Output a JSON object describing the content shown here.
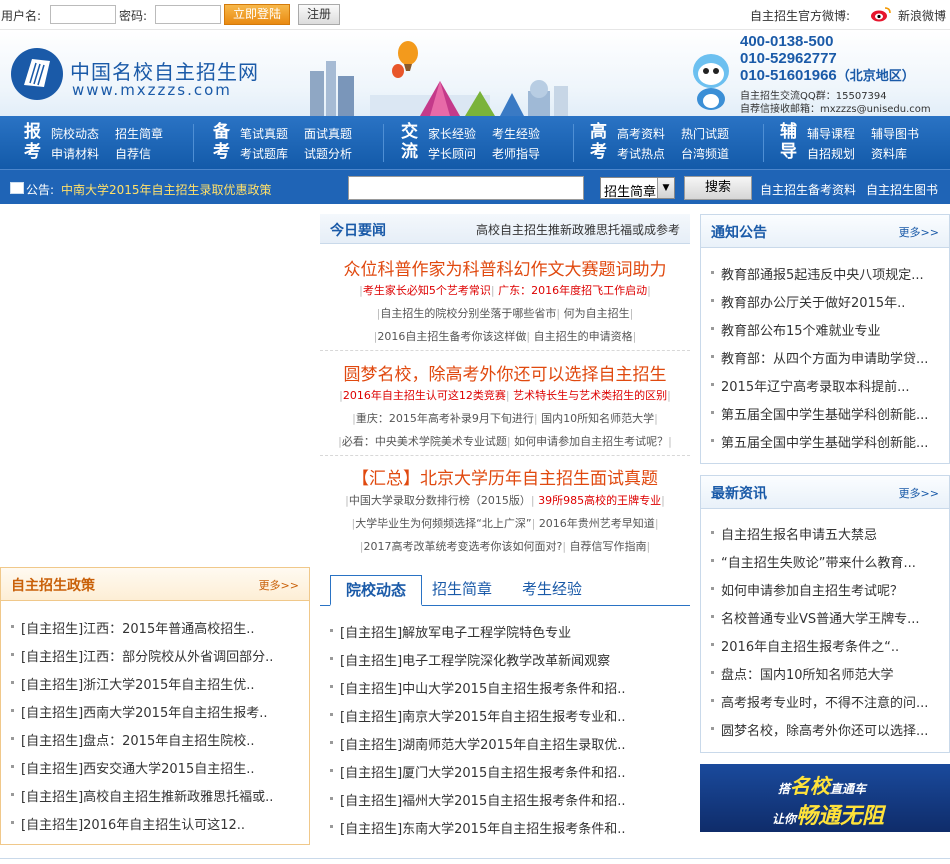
{
  "login": {
    "username_label": "用户名:",
    "password_label": "密码:",
    "login_button": "立即登陆",
    "register_button": "注册",
    "weibo_label": "自主招生官方微博:",
    "weibo_link": "新浪微博"
  },
  "header": {
    "logo_cn": "中国名校自主招生网",
    "logo_en": "www.mxzzzs.com",
    "phones": [
      "400-0138-500",
      "010-52962777",
      "010-51601966"
    ],
    "phone_area": "（北京地区）",
    "qq": "自主招生交流QQ群：15507394",
    "email": "自荐信接收邮箱：mxzzzs@unisedu.com"
  },
  "nav": [
    {
      "cat": "报考",
      "links": [
        "院校动态",
        "招生简章",
        "申请材料",
        "自荐信"
      ]
    },
    {
      "cat": "备考",
      "links": [
        "笔试真题",
        "面试真题",
        "考试题库",
        "试题分析"
      ]
    },
    {
      "cat": "交流",
      "links": [
        "家长经验",
        "考生经验",
        "学长顾问",
        "老师指导"
      ]
    },
    {
      "cat": "高考",
      "links": [
        "高考资料",
        "热门试题",
        "考试热点",
        "台湾频道"
      ]
    },
    {
      "cat": "辅导",
      "links": [
        "辅导课程",
        "辅导图书",
        "自招规划",
        "资料库"
      ]
    }
  ],
  "notice": {
    "label": "公告:",
    "text": "中南大学2015年自主招生录取优惠政策",
    "search_select": "招生简章",
    "search_button": "搜索",
    "links": [
      "自主招生备考资料",
      "自主招生图书"
    ]
  },
  "today": {
    "title": "今日要闻",
    "right": "高校自主招生推新政雅思托福或成参考",
    "blocks": [
      {
        "headline": "众位科普作家为科普科幻作文大赛题词助力",
        "lines": [
          [
            {
              "t": "考生家长必知5个艺考常识",
              "red": true
            },
            {
              "t": "广东：2016年度招飞工作启动",
              "red": true
            }
          ],
          [
            {
              "t": "自主招生的院校分别坐落于哪些省市",
              "red": false
            },
            {
              "t": "何为自主招生",
              "red": false
            }
          ],
          [
            {
              "t": "2016自主招生备考你该这样做",
              "red": false
            },
            {
              "t": "自主招生的申请资格",
              "red": false
            }
          ]
        ]
      },
      {
        "headline": "圆梦名校，除高考外你还可以选择自主招生",
        "lines": [
          [
            {
              "t": "2016年自主招生认可这12类竞赛",
              "red": true
            },
            {
              "t": "艺术特长生与艺术类招生的区别",
              "red": true
            }
          ],
          [
            {
              "t": "重庆：2015年高考补录9月下旬进行",
              "red": false
            },
            {
              "t": "国内10所知名师范大学",
              "red": false
            }
          ],
          [
            {
              "t": "必看：中央美术学院美术专业试题",
              "red": false
            },
            {
              "t": "如何申请参加自主招生考试呢？",
              "red": false
            }
          ]
        ]
      },
      {
        "headline": "【汇总】北京大学历年自主招生面试真题",
        "lines": [
          [
            {
              "t": "中国大学录取分数排行榜（2015版）",
              "red": false
            },
            {
              "t": "39所985高校的王牌专业",
              "red": true
            }
          ],
          [
            {
              "t": "大学毕业生为何频频选择“北上广深”",
              "red": false
            },
            {
              "t": "2016年贵州艺考早知道",
              "red": false
            }
          ],
          [
            {
              "t": "2017高考改革统考变选考你该如何面对?",
              "red": false
            },
            {
              "t": "自荐信写作指南",
              "red": false
            }
          ]
        ]
      }
    ]
  },
  "tabs": [
    "院校动态",
    "招生简章",
    "考生经验"
  ],
  "center_list": [
    "[自主招生]解放军电子工程学院特色专业",
    "[自主招生]电子工程学院深化教学改革新闻观察",
    "[自主招生]中山大学2015自主招生报考条件和招..",
    "[自主招生]南京大学2015年自主招生报考专业和..",
    "[自主招生]湖南师范大学2015年自主招生录取优..",
    "[自主招生]厦门大学2015自主招生报考条件和招..",
    "[自主招生]福州大学2015自主招生报考条件和招..",
    "[自主招生]东南大学2015年自主招生报考条件和.."
  ],
  "policy": {
    "title": "自主招生政策",
    "more": "更多>>",
    "items": [
      "[自主招生]江西：2015年普通高校招生..",
      "[自主招生]江西：部分院校从外省调回部分..",
      "[自主招生]浙江大学2015年自主招生优..",
      "[自主招生]西南大学2015年自主招生报考..",
      "[自主招生]盘点：2015年自主招生院校..",
      "[自主招生]西安交通大学2015自主招生..",
      "[自主招生]高校自主招生推新政雅思托福或..",
      "[自主招生]2016年自主招生认可这12.."
    ]
  },
  "announcements": {
    "title": "通知公告",
    "more": "更多>>",
    "items": [
      "教育部通报5起违反中央八项规定...",
      "教育部办公厅关于做好2015年..",
      "教育部公布15个难就业专业",
      "教育部：从四个方面为申请助学贷...",
      "2015年辽宁高考录取本科提前...",
      "第五届全国中学生基础学科创新能...",
      "第五届全国中学生基础学科创新能..."
    ]
  },
  "news": {
    "title": "最新资讯",
    "more": "更多>>",
    "items": [
      "自主招生报名申请五大禁忌",
      "“自主招生失败论”带来什么教育...",
      "如何申请参加自主招生考试呢？",
      "名校普通专业VS普通大学王牌专...",
      "2016年自主招生报考条件之“..",
      "盘点：国内10所知名师范大学",
      "高考报考专业时，不得不注意的问...",
      "圆梦名校，除高考外你还可以选择..."
    ]
  },
  "ad": {
    "line1_prefix": "搭",
    "line1_main": "名校",
    "line1_suffix": "直通车",
    "line2_prefix": "让你",
    "line2_main": "畅通无阻"
  }
}
